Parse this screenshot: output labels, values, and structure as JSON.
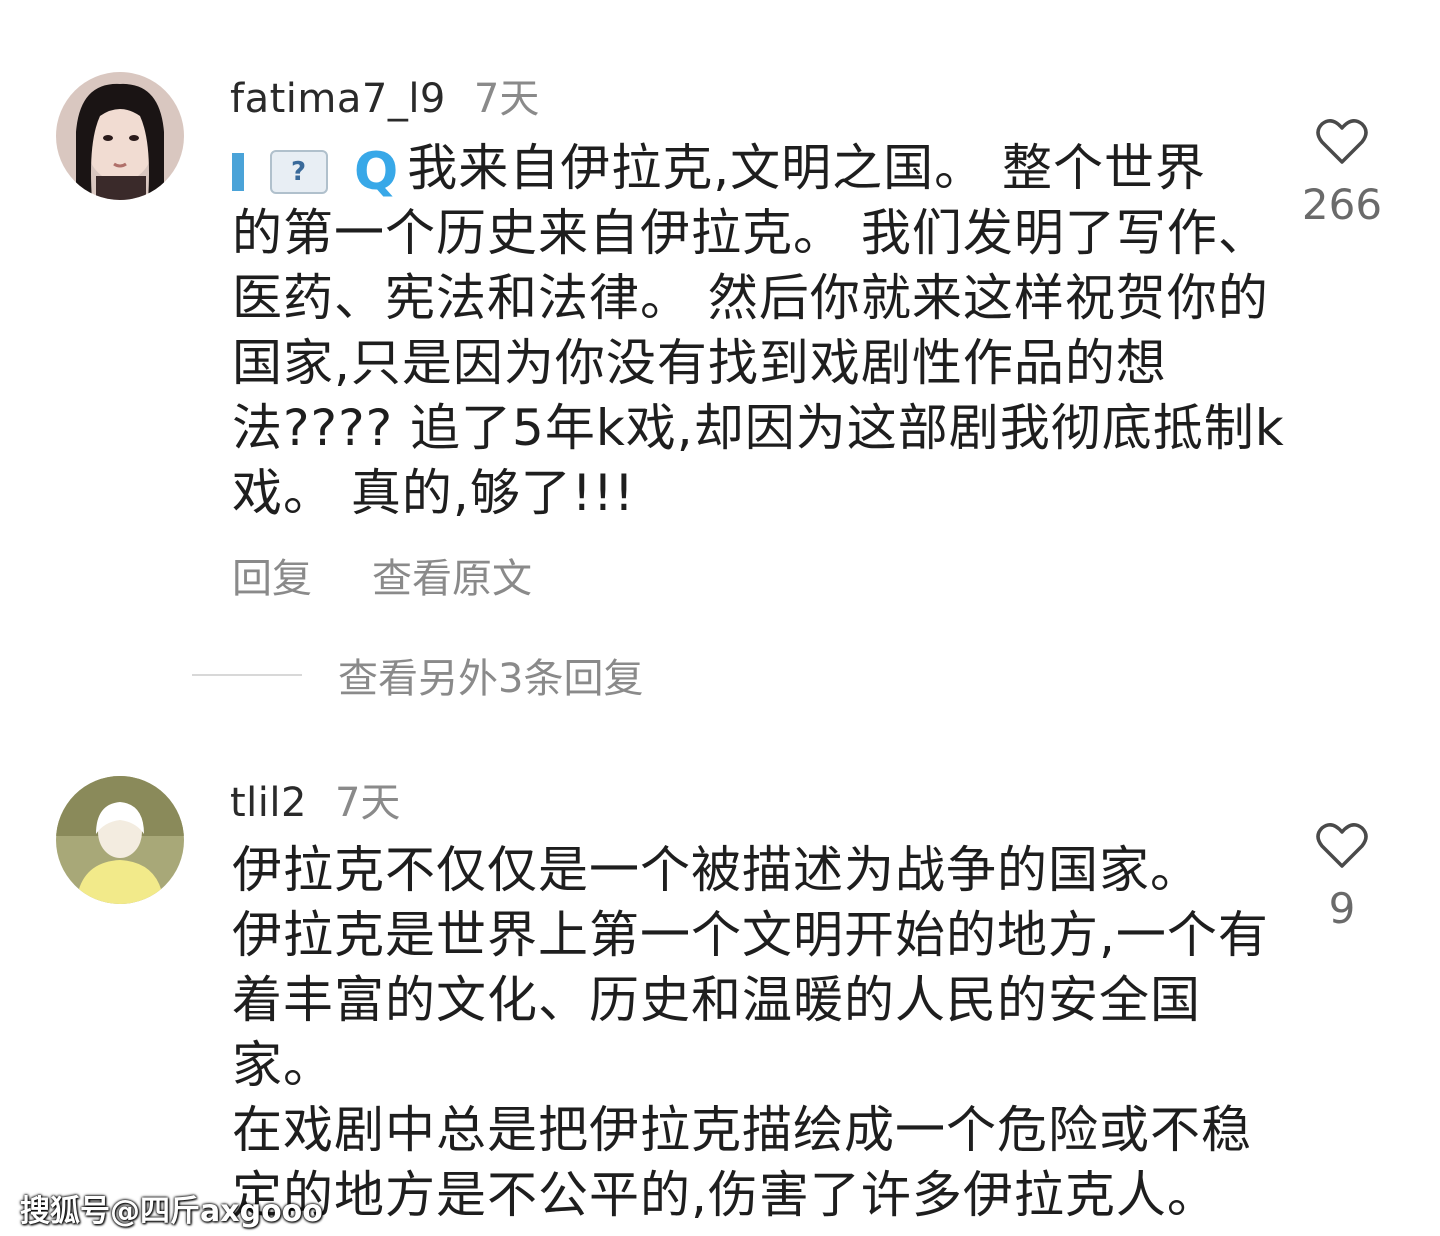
{
  "comments": [
    {
      "username": "fatima7_l9",
      "time": "7天",
      "inline_icons": [
        "bar-icon",
        "flag-icon",
        "q-icon"
      ],
      "flag_glyph": "?",
      "q_glyph": "Q",
      "lines": [
        "我来自伊拉克,文明之国。 整个世界",
        "的第一个历史来自伊拉克。 我们发明了写作、",
        "医药、宪法和法律。 然后你就来这样祝贺你的",
        "国家,只是因为你没有找到戏剧性作品的想",
        "法???? 追了5年k戏,却因为这部剧我彻底抵制k",
        "戏。 真的,够了!!!"
      ],
      "actions": {
        "reply": "回复",
        "view_original": "查看原文"
      },
      "likes": "266",
      "more_replies": "查看另外3条回复"
    },
    {
      "username": "tlil2",
      "time": "7天",
      "lines": [
        "伊拉克不仅仅是一个被描述为战争的国家。",
        "伊拉克是世界上第一个文明开始的地方,一个有",
        "着丰富的文化、历史和温暖的人民的安全国",
        "家。",
        "在戏剧中总是把伊拉克描绘成一个危险或不稳",
        "定的地方是不公平的,伤害了许多伊拉克人。"
      ],
      "likes": "9"
    }
  ],
  "watermark": "搜狐号@四斤axgooo",
  "colors": {
    "accent_blue": "#38a8e8",
    "muted_text": "#8a8a8a"
  }
}
